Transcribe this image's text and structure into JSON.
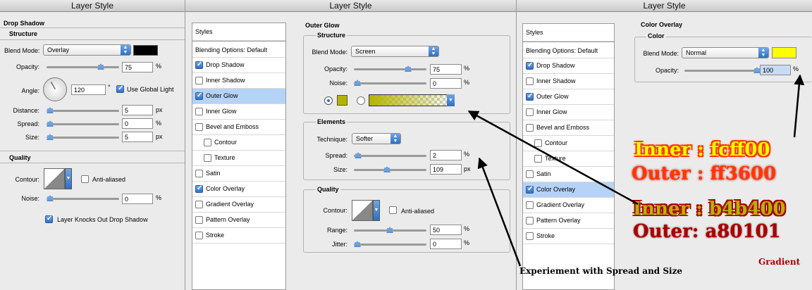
{
  "panel1": {
    "title": "Layer Style",
    "section": "Drop Shadow",
    "structure": "Structure",
    "blend_mode_label": "Blend Mode:",
    "blend_mode": "Overlay",
    "opacity_label": "Opacity:",
    "opacity": "75",
    "angle_label": "Angle:",
    "angle": "120",
    "deg": "°",
    "use_global_light": "Use Global Light",
    "distance_label": "Distance:",
    "distance": "5",
    "spread_label": "Spread:",
    "spread": "0",
    "size_label": "Size:",
    "size": "5",
    "quality": "Quality",
    "contour_label": "Contour:",
    "anti_aliased": "Anti-aliased",
    "noise_label": "Noise:",
    "noise": "0",
    "knockout": "Layer Knocks Out Drop Shadow",
    "pct": "%",
    "px": "px",
    "shadow_color": "#000000"
  },
  "panel2": {
    "title": "Layer Style",
    "styles_label": "Styles",
    "blending_options": "Blending Options: Default",
    "items": [
      {
        "label": "Drop Shadow",
        "checked": true
      },
      {
        "label": "Inner Shadow",
        "checked": false
      },
      {
        "label": "Outer Glow",
        "checked": true
      },
      {
        "label": "Inner Glow",
        "checked": false
      },
      {
        "label": "Bevel and Emboss",
        "checked": false
      },
      {
        "label": "Contour",
        "checked": false
      },
      {
        "label": "Texture",
        "checked": false
      },
      {
        "label": "Satin",
        "checked": false
      },
      {
        "label": "Color Overlay",
        "checked": true
      },
      {
        "label": "Gradient Overlay",
        "checked": false
      },
      {
        "label": "Pattern Overlay",
        "checked": false
      },
      {
        "label": "Stroke",
        "checked": false
      }
    ],
    "section": "Outer Glow",
    "structure": "Structure",
    "blend_mode_label": "Blend Mode:",
    "blend_mode": "Screen",
    "opacity_label": "Opacity:",
    "opacity": "75",
    "noise_label": "Noise:",
    "noise": "0",
    "elements": "Elements",
    "technique_label": "Technique:",
    "technique": "Softer",
    "spread_label": "Spread:",
    "spread": "2",
    "size_label": "Size:",
    "size": "109",
    "quality": "Quality",
    "contour_label": "Contour:",
    "anti_aliased": "Anti-aliased",
    "range_label": "Range:",
    "range": "50",
    "jitter_label": "Jitter:",
    "jitter": "0",
    "pct": "%",
    "px": "px",
    "glow_color": "#b4b400"
  },
  "panel3": {
    "title": "Layer Style",
    "styles_label": "Styles",
    "blending_options": "Blending Options: Default",
    "items": [
      {
        "label": "Drop Shadow",
        "checked": true
      },
      {
        "label": "Inner Shadow",
        "checked": false
      },
      {
        "label": "Outer Glow",
        "checked": true
      },
      {
        "label": "Inner Glow",
        "checked": false
      },
      {
        "label": "Bevel and Emboss",
        "checked": false
      },
      {
        "label": "Contour",
        "checked": false
      },
      {
        "label": "Texture",
        "checked": false
      },
      {
        "label": "Satin",
        "checked": false
      },
      {
        "label": "Color Overlay",
        "checked": true
      },
      {
        "label": "Gradient Overlay",
        "checked": false
      },
      {
        "label": "Pattern Overlay",
        "checked": false
      },
      {
        "label": "Stroke",
        "checked": false
      }
    ],
    "section": "Color Overlay",
    "color": "Color",
    "blend_mode_label": "Blend Mode:",
    "blend_mode": "Normal",
    "opacity_label": "Opacity:",
    "opacity": "100",
    "pct": "%",
    "overlay_color": "#fcff00"
  },
  "annotations": {
    "line1": "Inner : fcff00",
    "line2": "Outer : ff3600",
    "line3": "Inner : b4b400",
    "line4": "Outer: a80101",
    "gradient": "Gradient",
    "experiment": "Experiement with Spread and Size"
  }
}
